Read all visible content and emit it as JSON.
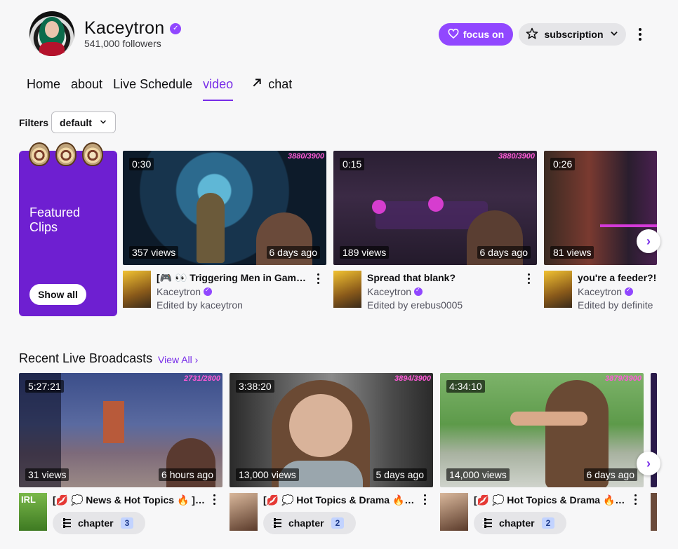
{
  "channel": {
    "name": "Kaceytron",
    "followers": "541,000 followers"
  },
  "header": {
    "focus_label": "focus on",
    "subscription_label": "subscription",
    "heart_icon": "heart-icon",
    "star_icon": "star-icon"
  },
  "tabs": [
    {
      "label": "Home"
    },
    {
      "label": "about"
    },
    {
      "label": "Live Schedule"
    },
    {
      "label": "video",
      "active": true
    },
    {
      "label": "chat",
      "icon": "arrow-out-icon"
    }
  ],
  "filters": {
    "label": "Filters",
    "value": "default"
  },
  "featured": {
    "title": "Featured Clips",
    "show_all": "Show all"
  },
  "clips": [
    {
      "duration": "0:30",
      "views": "357 views",
      "ago": "6 days ago",
      "score": "3880/3900",
      "title": "[🎮 👀 Triggering Men in Game...",
      "channel": "Kaceytron",
      "edited": "Edited by kaceytron"
    },
    {
      "duration": "0:15",
      "views": "189 views",
      "ago": "6 days ago",
      "score": "3880/3900",
      "title": "Spread that blank?",
      "channel": "Kaceytron",
      "edited": "Edited by erebus0005"
    },
    {
      "duration": "0:26",
      "views": "81 views",
      "ago": "",
      "score": "",
      "title": "you're a feeder?!",
      "channel": "Kaceytron",
      "edited": "Edited by definite"
    }
  ],
  "recent": {
    "title": "Recent Live Broadcasts",
    "view_all": "View All ›",
    "items": [
      {
        "duration": "5:27:21",
        "views": "31 views",
        "ago": "6 hours ago",
        "score": "2731/2800",
        "title": "[💋 💭 News & Hot Topics 🔥 ][...",
        "chapter": "chapter",
        "count": "3",
        "thumb_label": "IRL"
      },
      {
        "duration": "3:38:20",
        "views": "13,000 views",
        "ago": "5 days ago",
        "score": "3894/3900",
        "title": "[💋 💭 Hot Topics & Drama 🔥 ]...",
        "chapter": "chapter",
        "count": "2",
        "thumb_label": ""
      },
      {
        "duration": "4:34:10",
        "views": "14,000 views",
        "ago": "6 days ago",
        "score": "3879/3900",
        "title": "[💋 💭 Hot Topics & Drama 🔥 ]...",
        "chapter": "chapter",
        "count": "2",
        "thumb_label": ""
      }
    ]
  },
  "colors": {
    "accent": "#9147ff",
    "featured_bg": "#6e1fd1",
    "page_bg": "#f7f7f8"
  }
}
